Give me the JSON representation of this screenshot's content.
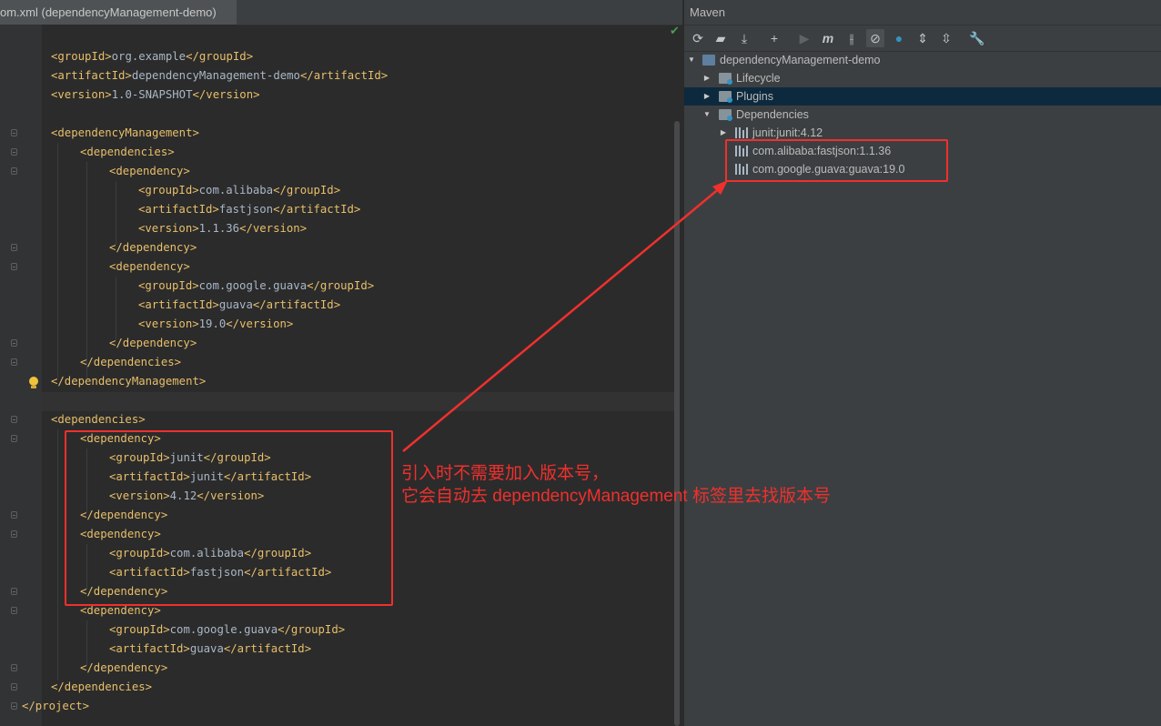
{
  "editor": {
    "tab_title": "om.xml (dependencyManagement-demo)",
    "lines": [
      {
        "indent": 0,
        "parts": []
      },
      {
        "indent": 0,
        "parts": [
          [
            "t",
            "<groupId>"
          ],
          [
            "v",
            "org.example"
          ],
          [
            "t",
            "</groupId>"
          ]
        ]
      },
      {
        "indent": 0,
        "parts": [
          [
            "t",
            "<artifactId>"
          ],
          [
            "v",
            "dependencyManagement-demo"
          ],
          [
            "t",
            "</artifactId>"
          ]
        ]
      },
      {
        "indent": 0,
        "parts": [
          [
            "t",
            "<version>"
          ],
          [
            "v",
            "1.0-SNAPSHOT"
          ],
          [
            "t",
            "</version>"
          ]
        ]
      },
      {
        "indent": 0,
        "parts": []
      },
      {
        "indent": 0,
        "parts": [
          [
            "t",
            "<dependencyManagement>"
          ]
        ]
      },
      {
        "indent": 1,
        "parts": [
          [
            "t",
            "<dependencies>"
          ]
        ]
      },
      {
        "indent": 2,
        "parts": [
          [
            "t",
            "<dependency>"
          ]
        ]
      },
      {
        "indent": 3,
        "parts": [
          [
            "t",
            "<groupId>"
          ],
          [
            "v",
            "com.alibaba"
          ],
          [
            "t",
            "</groupId>"
          ]
        ]
      },
      {
        "indent": 3,
        "parts": [
          [
            "t",
            "<artifactId>"
          ],
          [
            "v",
            "fastjson"
          ],
          [
            "t",
            "</artifactId>"
          ]
        ]
      },
      {
        "indent": 3,
        "parts": [
          [
            "t",
            "<version>"
          ],
          [
            "v",
            "1.1.36"
          ],
          [
            "t",
            "</version>"
          ]
        ]
      },
      {
        "indent": 2,
        "parts": [
          [
            "t",
            "</dependency>"
          ]
        ]
      },
      {
        "indent": 2,
        "parts": [
          [
            "t",
            "<dependency>"
          ]
        ]
      },
      {
        "indent": 3,
        "parts": [
          [
            "t",
            "<groupId>"
          ],
          [
            "v",
            "com.google.guava"
          ],
          [
            "t",
            "</groupId>"
          ]
        ]
      },
      {
        "indent": 3,
        "parts": [
          [
            "t",
            "<artifactId>"
          ],
          [
            "v",
            "guava"
          ],
          [
            "t",
            "</artifactId>"
          ]
        ]
      },
      {
        "indent": 3,
        "parts": [
          [
            "t",
            "<version>"
          ],
          [
            "v",
            "19.0"
          ],
          [
            "t",
            "</version>"
          ]
        ]
      },
      {
        "indent": 2,
        "parts": [
          [
            "t",
            "</dependency>"
          ]
        ]
      },
      {
        "indent": 1,
        "parts": [
          [
            "t",
            "</dependencies>"
          ]
        ]
      },
      {
        "indent": 0,
        "parts": [
          [
            "t",
            "</dependencyManagement>"
          ]
        ]
      },
      {
        "indent": 0,
        "parts": []
      },
      {
        "indent": 0,
        "parts": [
          [
            "t",
            "<dependencies>"
          ]
        ]
      },
      {
        "indent": 1,
        "parts": [
          [
            "t",
            "<dependency>"
          ]
        ]
      },
      {
        "indent": 2,
        "parts": [
          [
            "t",
            "<groupId>"
          ],
          [
            "v",
            "junit"
          ],
          [
            "t",
            "</groupId>"
          ]
        ]
      },
      {
        "indent": 2,
        "parts": [
          [
            "t",
            "<artifactId>"
          ],
          [
            "v",
            "junit"
          ],
          [
            "t",
            "</artifactId>"
          ]
        ]
      },
      {
        "indent": 2,
        "parts": [
          [
            "t",
            "<version>"
          ],
          [
            "v",
            "4.12"
          ],
          [
            "t",
            "</version>"
          ]
        ]
      },
      {
        "indent": 1,
        "parts": [
          [
            "t",
            "</dependency>"
          ]
        ]
      },
      {
        "indent": 1,
        "parts": [
          [
            "t",
            "<dependency>"
          ]
        ]
      },
      {
        "indent": 2,
        "parts": [
          [
            "t",
            "<groupId>"
          ],
          [
            "v",
            "com.alibaba"
          ],
          [
            "t",
            "</groupId>"
          ]
        ]
      },
      {
        "indent": 2,
        "parts": [
          [
            "t",
            "<artifactId>"
          ],
          [
            "v",
            "fastjson"
          ],
          [
            "t",
            "</artifactId>"
          ]
        ]
      },
      {
        "indent": 1,
        "parts": [
          [
            "t",
            "</dependency>"
          ]
        ]
      },
      {
        "indent": 1,
        "parts": [
          [
            "t",
            "<dependency>"
          ]
        ]
      },
      {
        "indent": 2,
        "parts": [
          [
            "t",
            "<groupId>"
          ],
          [
            "v",
            "com.google.guava"
          ],
          [
            "t",
            "</groupId>"
          ]
        ]
      },
      {
        "indent": 2,
        "parts": [
          [
            "t",
            "<artifactId>"
          ],
          [
            "v",
            "guava"
          ],
          [
            "t",
            "</artifactId>"
          ]
        ]
      },
      {
        "indent": 1,
        "parts": [
          [
            "t",
            "</dependency>"
          ]
        ]
      },
      {
        "indent": 0,
        "parts": [
          [
            "t",
            "</dependencies>"
          ]
        ]
      },
      {
        "indent": -1,
        "parts": [
          [
            "t",
            "</project>"
          ]
        ]
      }
    ]
  },
  "maven": {
    "title": "Maven",
    "toolbar": [
      "reload-icon",
      "add-folder-icon",
      "download-icon",
      "plus-icon",
      "run-icon",
      "execute-goal-icon",
      "toggle-offline-icon",
      "skip-tests-icon",
      "show-dependencies-icon",
      "expand-all-icon",
      "collapse-all-icon",
      "settings-wrench-icon"
    ],
    "tree": {
      "root": "dependencyManagement-demo",
      "lifecycle": "Lifecycle",
      "plugins": "Plugins",
      "dependencies": "Dependencies",
      "deps": [
        "junit:junit:4.12",
        "com.alibaba:fastjson:1.1.36",
        "com.google.guava:guava:19.0"
      ]
    }
  },
  "annotation": {
    "line1": "引入时不需要加入版本号，",
    "line2": "它会自动去 dependencyManagement 标签里去找版本号",
    "color": "#f0302d"
  },
  "colors": {
    "tag": "#e8bf6a",
    "text": "#a9b7c6",
    "bg": "#2b2b2b",
    "panel": "#3c3f41",
    "selection": "#0d293e"
  }
}
